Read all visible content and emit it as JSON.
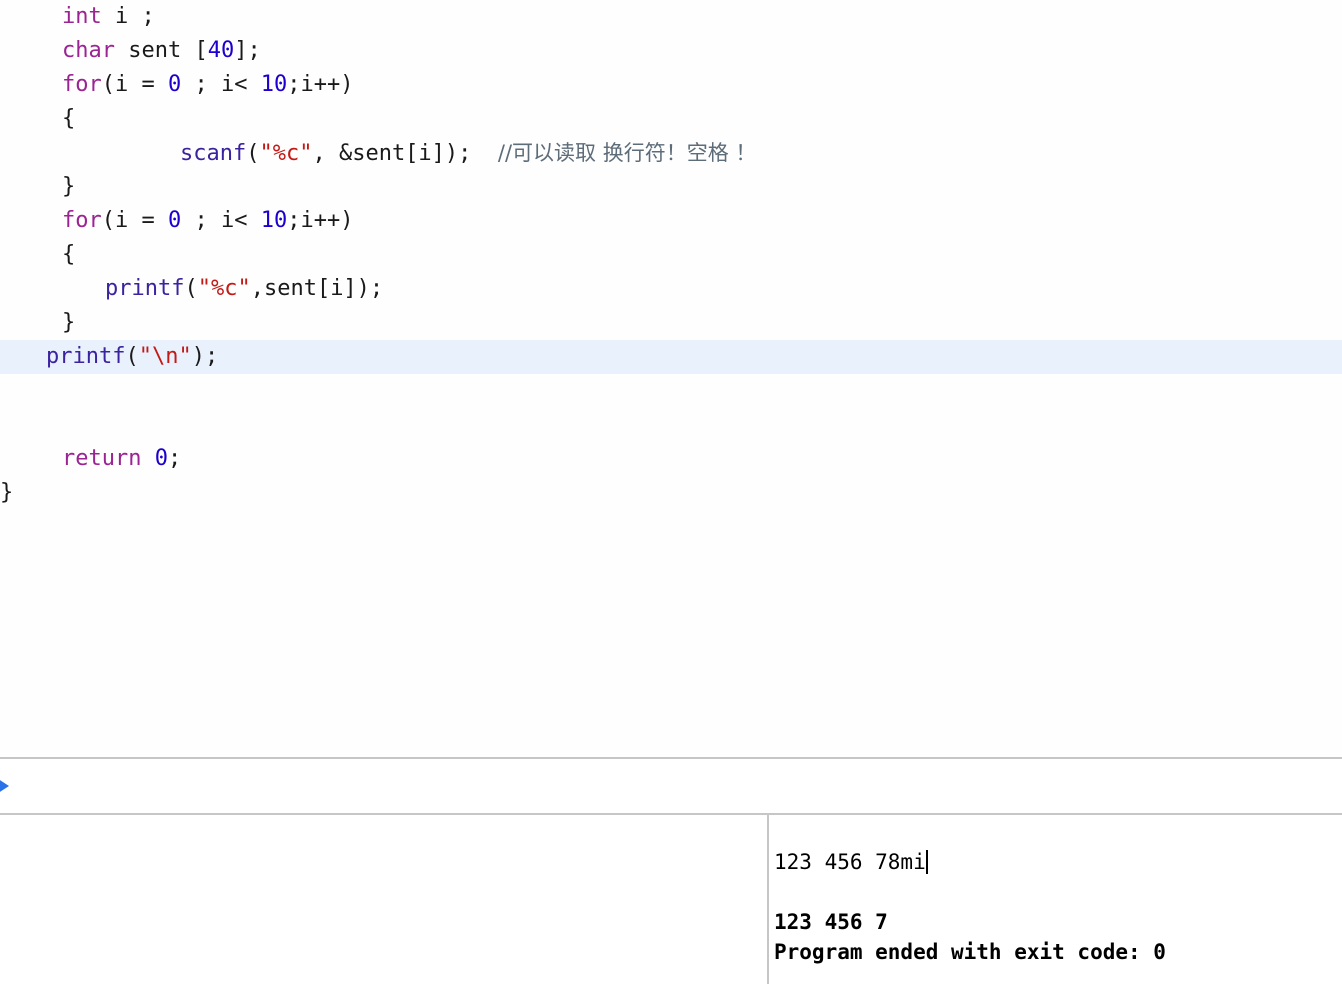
{
  "editor": {
    "language": "c",
    "highlighted_line_index": 10,
    "highlight_color": "#e9f1fd",
    "background_color": "#fefefe",
    "syntax_colors": {
      "keyword": "#9b2393",
      "number": "#1c00cf",
      "function": "#3b23a0",
      "string": "#c41a16",
      "comment": "#5d6c79",
      "plain": "#1a1a1a"
    },
    "lines": [
      {
        "tokens": [
          {
            "t": "int",
            "c": "kw"
          },
          {
            "t": " i ;",
            "c": "plain"
          }
        ],
        "indent": "ind1"
      },
      {
        "tokens": [
          {
            "t": "char",
            "c": "kw"
          },
          {
            "t": " sent [",
            "c": "plain"
          },
          {
            "t": "40",
            "c": "num"
          },
          {
            "t": "];",
            "c": "plain"
          }
        ],
        "indent": "ind1"
      },
      {
        "tokens": [
          {
            "t": "for",
            "c": "kw"
          },
          {
            "t": "(i = ",
            "c": "plain"
          },
          {
            "t": "0",
            "c": "num"
          },
          {
            "t": " ; i< ",
            "c": "plain"
          },
          {
            "t": "10",
            "c": "num"
          },
          {
            "t": ";i++)",
            "c": "plain"
          }
        ],
        "indent": "ind1"
      },
      {
        "tokens": [
          {
            "t": "{",
            "c": "plain"
          }
        ],
        "indent": "ind1"
      },
      {
        "tokens": [
          {
            "t": "scanf",
            "c": "fn"
          },
          {
            "t": "(",
            "c": "plain"
          },
          {
            "t": "\"%c\"",
            "c": "str"
          },
          {
            "t": ", &sent[i]);  ",
            "c": "plain"
          },
          {
            "t": "//可以读取 换行符！空格 ！",
            "c": "comment"
          }
        ],
        "indent": "ind3"
      },
      {
        "tokens": [
          {
            "t": "}",
            "c": "plain"
          }
        ],
        "indent": "ind1"
      },
      {
        "tokens": [
          {
            "t": "for",
            "c": "kw"
          },
          {
            "t": "(i = ",
            "c": "plain"
          },
          {
            "t": "0",
            "c": "num"
          },
          {
            "t": " ; i< ",
            "c": "plain"
          },
          {
            "t": "10",
            "c": "num"
          },
          {
            "t": ";i++)",
            "c": "plain"
          }
        ],
        "indent": "ind1"
      },
      {
        "tokens": [
          {
            "t": "{",
            "c": "plain"
          }
        ],
        "indent": "ind1"
      },
      {
        "tokens": [
          {
            "t": "printf",
            "c": "fn"
          },
          {
            "t": "(",
            "c": "plain"
          },
          {
            "t": "\"%c\"",
            "c": "str"
          },
          {
            "t": ",sent[i]);",
            "c": "plain"
          }
        ],
        "indent": "ind2"
      },
      {
        "tokens": [
          {
            "t": "}",
            "c": "plain"
          }
        ],
        "indent": "ind1"
      },
      {
        "tokens": [
          {
            "t": "printf",
            "c": "fn"
          },
          {
            "t": "(",
            "c": "plain"
          },
          {
            "t": "\"\\n\"",
            "c": "str"
          },
          {
            "t": ");",
            "c": "plain"
          }
        ],
        "indent": "ind-hl",
        "highlighted": true
      },
      {
        "tokens": [
          {
            "t": "",
            "c": "plain"
          }
        ],
        "indent": "ind0"
      },
      {
        "tokens": [
          {
            "t": "",
            "c": "plain"
          }
        ],
        "indent": "ind0"
      },
      {
        "tokens": [
          {
            "t": "return",
            "c": "kw"
          },
          {
            "t": " ",
            "c": "plain"
          },
          {
            "t": "0",
            "c": "num"
          },
          {
            "t": ";",
            "c": "plain"
          }
        ],
        "indent": "ind1"
      },
      {
        "tokens": [
          {
            "t": "}",
            "c": "plain"
          }
        ],
        "indent": "ind0"
      }
    ]
  },
  "debug_bar": {
    "continue_icon": "play-triangle-icon",
    "continue_color": "#2a72e8"
  },
  "bottom": {
    "variables_pane_placeholder": "",
    "console": {
      "input_line": "123 456 78mi",
      "cursor_visible": true,
      "output_lines": [
        {
          "text": "123 456 7",
          "bold": true
        },
        {
          "text": "Program ended with exit code: 0",
          "bold": true
        }
      ]
    }
  }
}
